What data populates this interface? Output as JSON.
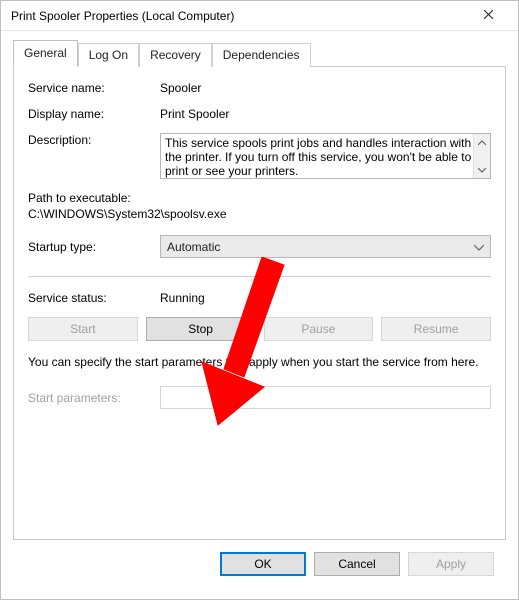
{
  "titlebar": {
    "title": "Print Spooler Properties (Local Computer)"
  },
  "tabs": {
    "general": "General",
    "logon": "Log On",
    "recovery": "Recovery",
    "dependencies": "Dependencies"
  },
  "labels": {
    "service_name": "Service name:",
    "display_name": "Display name:",
    "description": "Description:",
    "path_label": "Path to executable:",
    "startup_type": "Startup type:",
    "service_status": "Service status:",
    "start_params": "Start parameters:"
  },
  "values": {
    "service_name": "Spooler",
    "display_name": "Print Spooler",
    "description": "This service spools print jobs and handles interaction with the printer.  If you turn off this service, you won't be able to print or see your printers.",
    "path": "C:\\WINDOWS\\System32\\spoolsv.exe",
    "startup_type": "Automatic",
    "service_status": "Running"
  },
  "buttons": {
    "start": "Start",
    "stop": "Stop",
    "pause": "Pause",
    "resume": "Resume",
    "ok": "OK",
    "cancel": "Cancel",
    "apply": "Apply"
  },
  "help_text": "You can specify the start parameters that apply when you start the service from here.",
  "annotation": {
    "arrow_color": "#ff0000"
  }
}
